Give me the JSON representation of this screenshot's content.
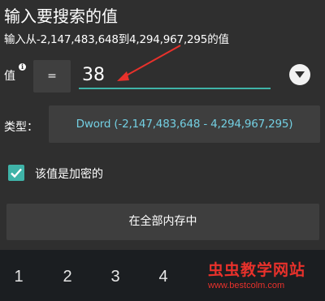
{
  "dialog": {
    "title": "输入要搜索的值",
    "subtitle": "输入从-2,147,483,648到4,294,967,295的值"
  },
  "value_row": {
    "label": "值",
    "info_icon": "i",
    "operator": "=",
    "input_value": "38",
    "dropdown_icon": "chevron-down-icon"
  },
  "type_row": {
    "label": "类型：",
    "selected": "Dword (-2,147,483,648 - 4,294,967,295)"
  },
  "encrypted_checkbox": {
    "checked": true,
    "label": "该值是加密的"
  },
  "search_button": {
    "label": "在全部内存中"
  },
  "keyboard": {
    "keys": [
      "1",
      "2",
      "3",
      "4"
    ]
  },
  "watermark": {
    "text": "虫虫教学网站",
    "url": "www.bestcolm.com"
  },
  "colors": {
    "accent": "#3fb3a8",
    "type_text": "#73cfe2",
    "annotation_arrow": "#e8312b"
  }
}
